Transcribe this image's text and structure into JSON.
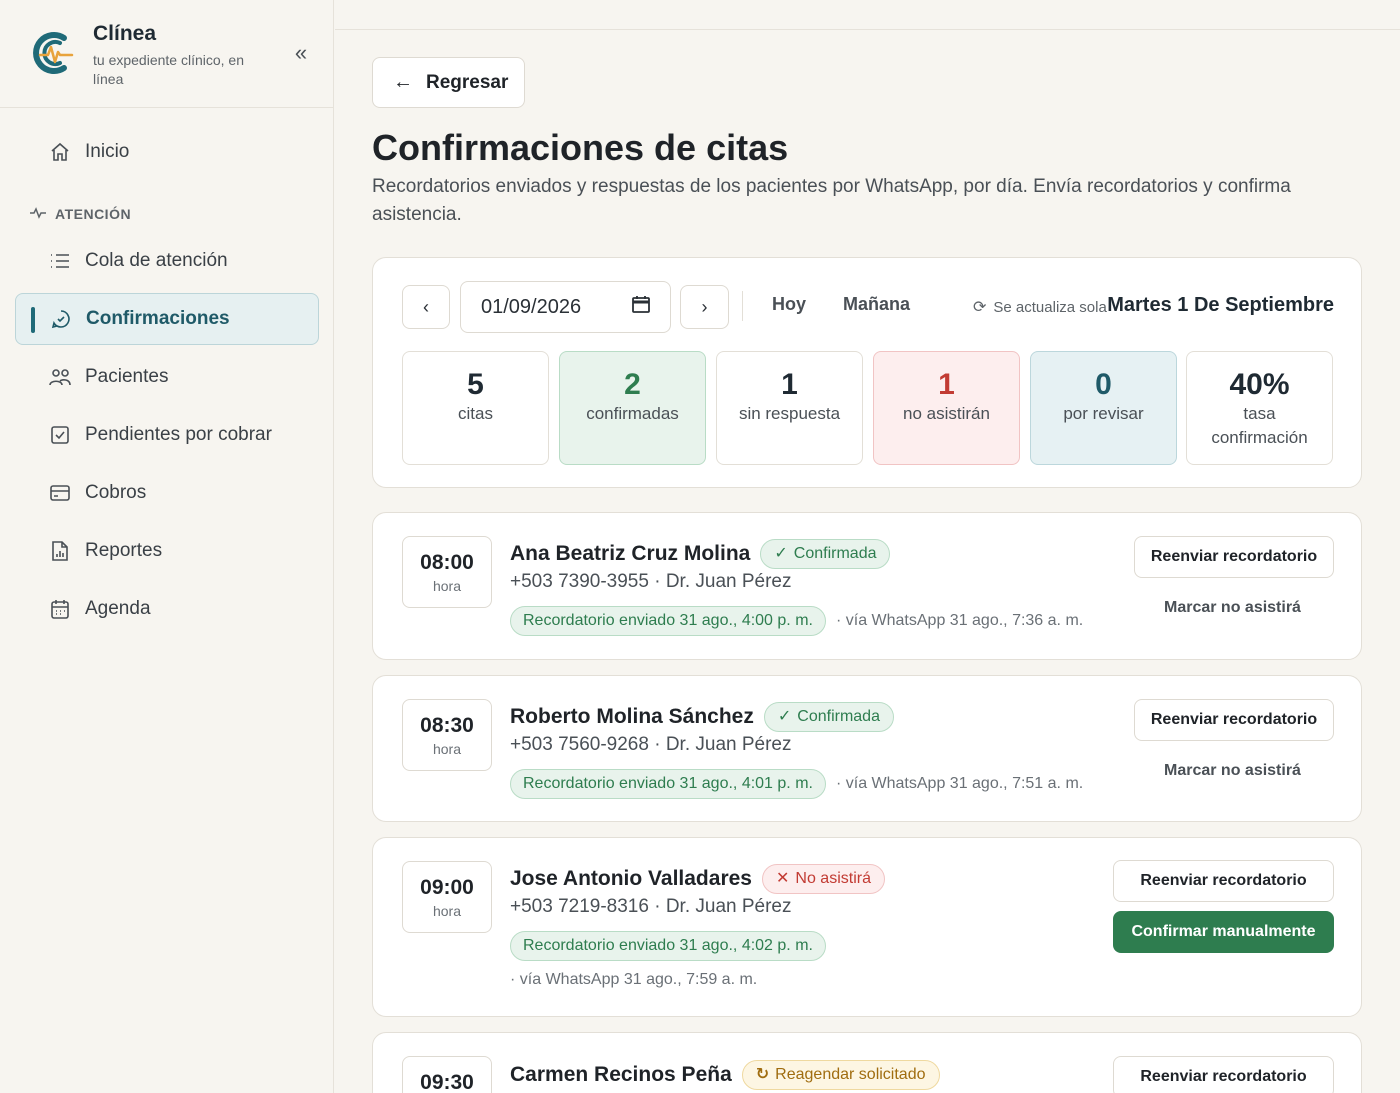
{
  "brand": {
    "name": "Clínea",
    "tagline": "tu expediente clínico, en línea"
  },
  "sidebar": {
    "items": [
      {
        "label": "Inicio",
        "icon": "home-icon"
      },
      {
        "label": "Cola de atención",
        "icon": "list-icon"
      },
      {
        "label": "Confirmaciones",
        "icon": "chat-check-icon",
        "active": true
      },
      {
        "label": "Pacientes",
        "icon": "users-icon"
      },
      {
        "label": "Pendientes por cobrar",
        "icon": "checkbox-icon"
      },
      {
        "label": "Cobros",
        "icon": "credit-card-icon"
      },
      {
        "label": "Reportes",
        "icon": "report-icon"
      },
      {
        "label": "Agenda",
        "icon": "calendar-icon"
      }
    ],
    "section_label": "ATENCIÓN"
  },
  "header": {
    "back_label": "Regresar",
    "title": "Confirmaciones de citas",
    "subtitle": "Recordatorios enviados y respuestas de los pacientes por WhatsApp, por día. Envía recordatorios y confirma asistencia."
  },
  "filters": {
    "date_value": "01/09/2026",
    "today_label": "Hoy",
    "tomorrow_label": "Mañana",
    "auto_refresh_label": "Se actualiza sola",
    "current_date": "Martes 1 De Septiembre"
  },
  "stats": [
    {
      "value": "5",
      "label": "citas"
    },
    {
      "value": "2",
      "label": "confirmadas"
    },
    {
      "value": "1",
      "label": "sin respuesta"
    },
    {
      "value": "1",
      "label": "no asistirán"
    },
    {
      "value": "0",
      "label": "por revisar"
    },
    {
      "value": "40%",
      "label": "tasa confirmación"
    }
  ],
  "appointments": [
    {
      "time": "08:00",
      "time_label": "hora",
      "name": "Ana Beatriz Cruz Molina",
      "status": "Confirmada",
      "info": "+503 7390-3955 · Dr. Juan Pérez",
      "reminder": "Recordatorio enviado 31 ago., 4:00 p. m.",
      "via": "· vía WhatsApp 31 ago., 7:36 a. m.",
      "resend_label": "Reenviar recordatorio",
      "secondary_label": "Marcar no asistirá"
    },
    {
      "time": "08:30",
      "time_label": "hora",
      "name": "Roberto Molina Sánchez",
      "status": "Confirmada",
      "info": "+503 7560-9268 · Dr. Juan Pérez",
      "reminder": "Recordatorio enviado 31 ago., 4:01 p. m.",
      "via": "· vía WhatsApp 31 ago., 7:51 a. m.",
      "resend_label": "Reenviar recordatorio",
      "secondary_label": "Marcar no asistirá"
    },
    {
      "time": "09:00",
      "time_label": "hora",
      "name": "Jose Antonio Valladares",
      "status": "No asistirá",
      "info": "+503 7219-8316 · Dr. Juan Pérez",
      "reminder": "Recordatorio enviado 31 ago., 4:02 p. m.",
      "via": "· vía WhatsApp 31 ago., 7:59 a. m.",
      "resend_label": "Reenviar recordatorio",
      "secondary_label": "Confirmar manualmente"
    },
    {
      "time": "09:30",
      "name": "Carmen Recinos Peña",
      "status": "Reagendar solicitado",
      "resend_label": "Reenviar recordatorio"
    }
  ],
  "colors": {
    "accent": "#1f6a78",
    "success": "#2e7d4f",
    "danger": "#c23b33",
    "warning": "#a06d10"
  }
}
